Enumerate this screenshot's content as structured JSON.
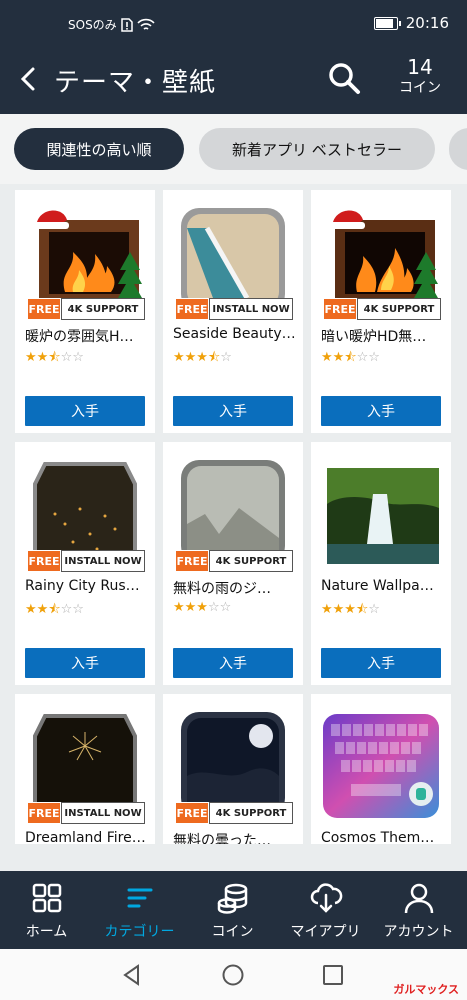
{
  "status_bar": {
    "left_text": "SOSのみ",
    "time": "20:16"
  },
  "header": {
    "title": "テーマ・壁紙",
    "coins_count": "14",
    "coins_label": "コイン"
  },
  "filters": [
    {
      "label": "関連性の高い順",
      "active": true
    },
    {
      "label": "新着アプリ ベストセラー",
      "active": false
    }
  ],
  "apps": [
    {
      "name": "暖炉の雰囲気H…",
      "badge_free": "FREE",
      "badge_tag": "4K SUPPORT",
      "rating": 2.5,
      "button": "入手"
    },
    {
      "name": "Seaside Beauty…",
      "badge_free": "FREE",
      "badge_tag": "INSTALL NOW",
      "rating": 3.5,
      "button": "入手"
    },
    {
      "name": "暗い暖炉HD無…",
      "badge_free": "FREE",
      "badge_tag": "4K SUPPORT",
      "rating": 2.5,
      "button": "入手"
    },
    {
      "name": "Rainy City Rus…",
      "badge_free": "FREE",
      "badge_tag": "INSTALL NOW",
      "rating": 2.5,
      "button": "入手"
    },
    {
      "name": "無料の雨のジ…",
      "badge_free": "FREE",
      "badge_tag": "4K SUPPORT",
      "rating": 3,
      "button": "入手"
    },
    {
      "name": "Nature Wallpa…",
      "badge_free": "",
      "badge_tag": "",
      "rating": 3.5,
      "button": "入手"
    },
    {
      "name": "Dreamland Fire…",
      "badge_free": "FREE",
      "badge_tag": "INSTALL NOW",
      "rating": null,
      "button": ""
    },
    {
      "name": "無料の曇った…",
      "badge_free": "FREE",
      "badge_tag": "4K SUPPORT",
      "rating": null,
      "button": ""
    },
    {
      "name": "Cosmos Them…",
      "badge_free": "",
      "badge_tag": "",
      "rating": null,
      "button": ""
    }
  ],
  "bottom_nav": [
    {
      "label": "ホーム",
      "icon": "home-grid-icon"
    },
    {
      "label": "カテゴリー",
      "icon": "category-lines-icon",
      "active": true
    },
    {
      "label": "コイン",
      "icon": "coins-stack-icon"
    },
    {
      "label": "マイアプリ",
      "icon": "cloud-download-icon"
    },
    {
      "label": "アカウント",
      "icon": "person-icon"
    }
  ],
  "watermark": "ガルマックス",
  "colors": {
    "header": "#232f3e",
    "accent": "#00a8e1",
    "button": "#0a6ebd",
    "star": "#f0a10b",
    "free_badge": "#ee6a1f"
  }
}
